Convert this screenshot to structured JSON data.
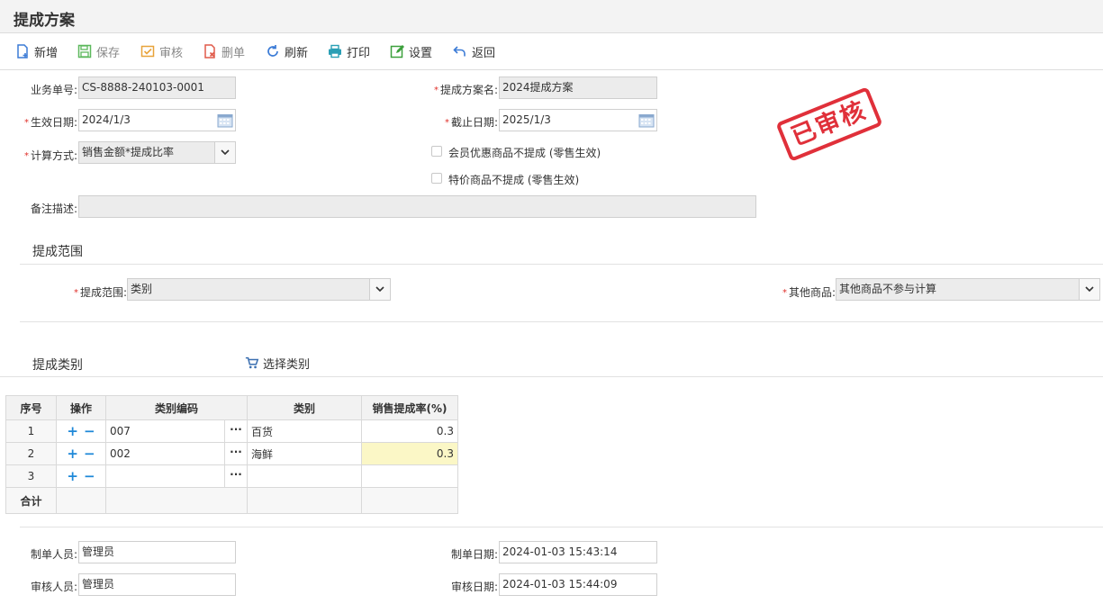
{
  "page_title": "提成方案",
  "toolbar": {
    "new": "新增",
    "save": "保存",
    "audit": "审核",
    "delete": "删单",
    "refresh": "刷新",
    "print": "打印",
    "settings": "设置",
    "back": "返回"
  },
  "form": {
    "doc_no_label": "业务单号:",
    "doc_no": "CS-8888-240103-0001",
    "plan_name_label": "提成方案名:",
    "plan_name": "2024提成方案",
    "effective_label": "生效日期:",
    "effective_date": "2024/1/3",
    "end_label": "截止日期:",
    "end_date": "2025/1/3",
    "calc_label": "计算方式:",
    "calc_method": "销售金额*提成比率",
    "member_discount_label": "会员优惠商品不提成 (零售生效)",
    "special_price_label": "特价商品不提成 (零售生效)",
    "remark_label": "备注描述:",
    "remark": ""
  },
  "stamp": "已审核",
  "scope_section": {
    "title": "提成范围",
    "scope_label": "提成范围:",
    "scope_value": "类别",
    "other_label": "其他商品:",
    "other_value": "其他商品不参与计算"
  },
  "category_section": {
    "title": "提成类别",
    "select_button": "选择类别"
  },
  "grid": {
    "headers": [
      "序号",
      "操作",
      "类别编码",
      "类别",
      "销售提成率(%)"
    ],
    "rows": [
      {
        "no": "1",
        "code": "007",
        "category": "百货",
        "rate": "0.3"
      },
      {
        "no": "2",
        "code": "002",
        "category": "海鲜",
        "rate": "0.3"
      },
      {
        "no": "3",
        "code": "",
        "category": "",
        "rate": ""
      }
    ],
    "total_label": "合计"
  },
  "footer": {
    "creator_label": "制单人员:",
    "creator": "管理员",
    "create_date_label": "制单日期:",
    "create_date": "2024-01-03 15:43:14",
    "auditor_label": "审核人员:",
    "auditor": "管理员",
    "audit_date_label": "审核日期:",
    "audit_date": "2024-01-03 15:44:09"
  },
  "colors": {
    "required": "#e0302a",
    "stamp": "#e0303a",
    "highlight_cell": "#fbf7c6",
    "op_icon": "#1e88d8"
  }
}
